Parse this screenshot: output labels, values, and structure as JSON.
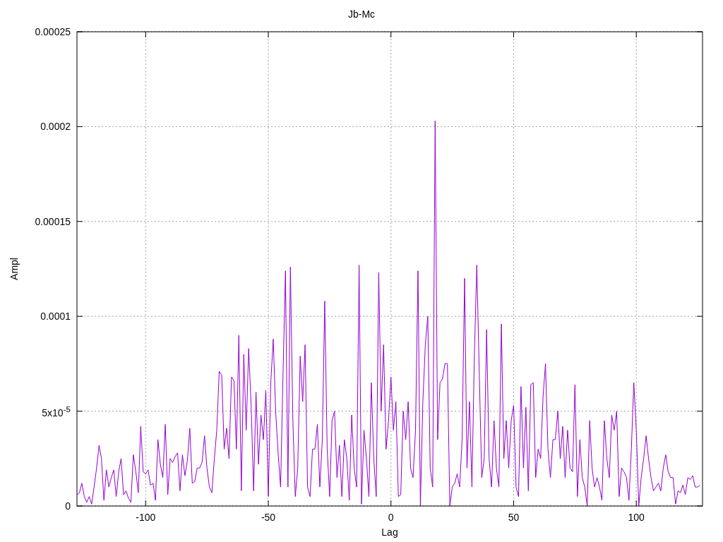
{
  "chart_data": {
    "type": "line",
    "title": "Jb-Mc",
    "grid": true,
    "xlabel": "Lag",
    "ylabel": "Ampl",
    "xlim": [
      -128,
      127
    ],
    "ylim": [
      0,
      0.00025
    ],
    "xticks": [
      -100,
      -50,
      0,
      50,
      100
    ],
    "yticks": [
      {
        "value": 0,
        "label": "0"
      },
      {
        "value": 5e-05,
        "label": "5x10$^{-5}$"
      },
      {
        "value": 0.0001,
        "label": "0.0001"
      },
      {
        "value": 0.00015,
        "label": "0.00015"
      },
      {
        "value": 0.0002,
        "label": "0.0002"
      },
      {
        "value": 0.00025,
        "label": "0.00025"
      }
    ],
    "x": [
      -128,
      -127,
      -126,
      -125,
      -124,
      -123,
      -122,
      -121,
      -120,
      -119,
      -118,
      -117,
      -116,
      -115,
      -114,
      -113,
      -112,
      -111,
      -110,
      -109,
      -108,
      -107,
      -106,
      -105,
      -104,
      -103,
      -102,
      -101,
      -100,
      -99,
      -98,
      -97,
      -96,
      -95,
      -94,
      -93,
      -92,
      -91,
      -90,
      -89,
      -88,
      -87,
      -86,
      -85,
      -84,
      -83,
      -82,
      -81,
      -80,
      -79,
      -78,
      -77,
      -76,
      -75,
      -74,
      -73,
      -72,
      -71,
      -70,
      -69,
      -68,
      -67,
      -66,
      -65,
      -64,
      -63,
      -62,
      -61,
      -60,
      -59,
      -58,
      -57,
      -56,
      -55,
      -54,
      -53,
      -52,
      -51,
      -50,
      -49,
      -48,
      -47,
      -46,
      -45,
      -44,
      -43,
      -42,
      -41,
      -40,
      -39,
      -38,
      -37,
      -36,
      -35,
      -34,
      -33,
      -32,
      -31,
      -30,
      -29,
      -28,
      -27,
      -26,
      -25,
      -24,
      -23,
      -22,
      -21,
      -20,
      -19,
      -18,
      -17,
      -16,
      -15,
      -14,
      -13,
      -12,
      -11,
      -10,
      -9,
      -8,
      -7,
      -6,
      -5,
      -4,
      -3,
      -2,
      -1,
      0,
      1,
      2,
      3,
      4,
      5,
      6,
      7,
      8,
      9,
      10,
      11,
      12,
      13,
      14,
      15,
      16,
      17,
      18,
      19,
      20,
      21,
      22,
      23,
      24,
      25,
      26,
      27,
      28,
      29,
      30,
      31,
      32,
      33,
      34,
      35,
      36,
      37,
      38,
      39,
      40,
      41,
      42,
      43,
      44,
      45,
      46,
      47,
      48,
      49,
      50,
      51,
      52,
      53,
      54,
      55,
      56,
      57,
      58,
      59,
      60,
      61,
      62,
      63,
      64,
      65,
      66,
      67,
      68,
      69,
      70,
      71,
      72,
      73,
      74,
      75,
      76,
      77,
      78,
      79,
      80,
      81,
      82,
      83,
      84,
      85,
      86,
      87,
      88,
      89,
      90,
      91,
      92,
      93,
      94,
      95,
      96,
      97,
      98,
      99,
      100,
      101,
      102,
      103,
      104,
      105,
      106,
      107,
      108,
      109,
      110,
      111,
      112,
      113,
      114,
      115,
      116,
      117,
      118,
      119,
      120,
      121,
      122,
      123,
      124,
      125,
      126
    ],
    "series": [
      {
        "color": "#9400d3",
        "values": [
          6e-06,
          7e-06,
          1.2e-05,
          5e-06,
          2e-06,
          5e-06,
          1e-06,
          1e-05,
          2e-05,
          3.2e-05,
          2.5e-05,
          3e-06,
          1.9e-05,
          1e-05,
          1.5e-05,
          1.9e-05,
          5e-06,
          1.8e-05,
          2.5e-05,
          6e-06,
          8e-06,
          4e-06,
          2e-06,
          2.7e-05,
          1.8e-05,
          7e-06,
          4.2e-05,
          1.8e-05,
          1.7e-05,
          1.9e-05,
          1.1e-05,
          1.2e-05,
          3e-06,
          3.5e-05,
          2.2e-05,
          1.5e-05,
          4.3e-05,
          6e-06,
          2.5e-05,
          2.3e-05,
          2.6e-05,
          2.8e-05,
          8e-06,
          2.7e-05,
          1.6e-05,
          2.4e-05,
          4.1e-05,
          1.2e-05,
          1.3e-05,
          2e-05,
          2e-05,
          2.3e-05,
          3.7e-05,
          2e-05,
          1e-05,
          7e-06,
          2.5e-05,
          4e-05,
          7.1e-05,
          6.9e-05,
          3e-05,
          4.1e-05,
          2.5e-05,
          6.8e-05,
          6.6e-05,
          3e-05,
          9e-05,
          8e-06,
          8e-05,
          4e-05,
          8.3e-05,
          5.3e-05,
          8e-06,
          6e-05,
          2.2e-05,
          4.8e-05,
          3.5e-05,
          6.1e-05,
          5e-06,
          6.5e-05,
          8.8e-05,
          5e-05,
          2.8e-05,
          1e-05,
          7e-05,
          0.000124,
          1e-05,
          0.000126,
          4.5e-05,
          5e-06,
          2e-05,
          7.9e-05,
          5.5e-05,
          8.5e-05,
          1e-05,
          5e-06,
          3e-05,
          3e-05,
          4.3e-05,
          1e-05,
          3.5e-05,
          0.000108,
          3e-05,
          5e-06,
          4.5e-05,
          5e-05,
          1.5e-05,
          3.2e-05,
          5e-06,
          3.5e-05,
          2.5e-05,
          3e-06,
          4.8e-05,
          2e-05,
          1e-05,
          0.000127,
          1e-06,
          4e-05,
          2.5e-05,
          5e-06,
          6.5e-05,
          2.5e-05,
          5e-06,
          0.000123,
          5e-05,
          8.5e-05,
          3e-05,
          4.5e-05,
          6.8e-05,
          4e-05,
          5.5e-05,
          5e-06,
          6e-06,
          5e-05,
          3.5e-05,
          5.5e-05,
          2e-05,
          1.5e-05,
          4e-05,
          0.000124,
          0.0,
          5.5e-05,
          8.5e-05,
          0.0001,
          2e-05,
          1e-05,
          0.000203,
          3.5e-05,
          6.5e-05,
          6.7e-05,
          7.5e-05,
          7.5e-05,
          0.0,
          1e-05,
          1.2e-05,
          1.7e-05,
          1e-05,
          3.5e-05,
          0.00012,
          2e-05,
          5.5e-05,
          1e-05,
          8e-05,
          0.000127,
          7e-05,
          1.5e-05,
          2.5e-05,
          9.3e-05,
          2.5e-05,
          1e-05,
          4.5e-05,
          2e-05,
          1e-05,
          9.6e-05,
          2.5e-05,
          4.5e-05,
          2e-05,
          4.5e-05,
          5.3e-05,
          1e-05,
          5e-06,
          6.3e-05,
          2e-05,
          5.2e-05,
          8e-06,
          6.4e-05,
          6.5e-05,
          1.5e-05,
          3e-05,
          2.5e-05,
          5.8e-05,
          7.5e-05,
          3e-05,
          1.5e-05,
          3.5e-05,
          3.5e-05,
          5e-05,
          2.5e-05,
          4.2e-05,
          1.5e-05,
          4e-05,
          2e-05,
          1.8e-05,
          6.4e-05,
          5e-06,
          3.5e-05,
          1.5e-05,
          1e-05,
          0.0,
          4.5e-05,
          2e-05,
          1e-05,
          1.5e-05,
          1e-05,
          3e-06,
          4.5e-05,
          2.5e-05,
          1.5e-05,
          4.8e-05,
          4e-05,
          5e-05,
          5e-06,
          2e-05,
          1.8e-05,
          1.5e-05,
          3e-06,
          3e-05,
          6.5e-05,
          4e-05,
          0.0,
          1.5e-05,
          2.5e-05,
          3.7e-05,
          2.5e-05,
          1.5e-05,
          8e-06,
          1e-05,
          1.2e-05,
          8e-06,
          2e-05,
          2.7e-05,
          1.8e-05,
          1.5e-05,
          1.5e-05,
          1e-06,
          8e-06,
          7e-06,
          1.1e-05,
          6e-06,
          1.5e-05,
          1.4e-05,
          1.6e-05,
          1e-05,
          1e-05,
          1.1e-05
        ]
      }
    ]
  }
}
